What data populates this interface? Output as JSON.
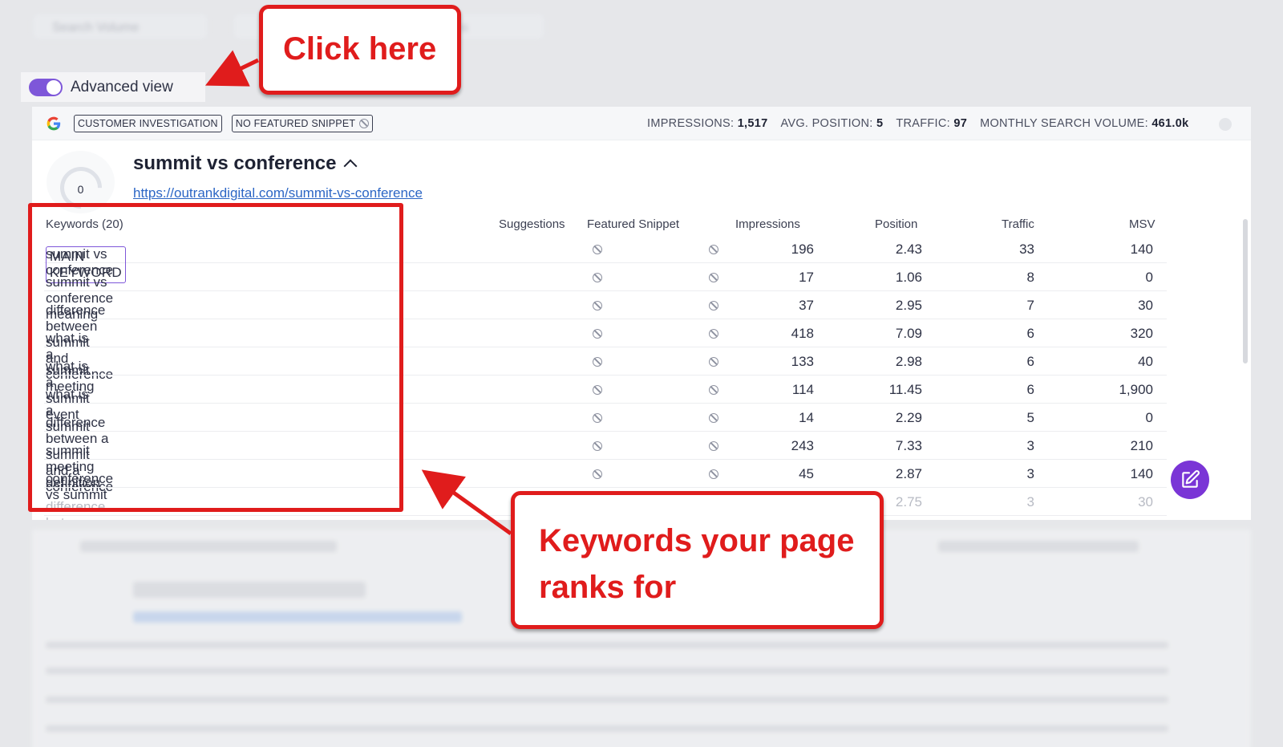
{
  "background_top": {
    "filter1": "Search Volume",
    "filter2": "...ions"
  },
  "toggle": {
    "label": "Advanced view",
    "on": true
  },
  "card": {
    "tags": [
      "CUSTOMER INVESTIGATION",
      "NO FEATURED SNIPPET"
    ],
    "metrics": [
      {
        "label": "IMPRESSIONS:",
        "value": "1,517"
      },
      {
        "label": "AVG. POSITION:",
        "value": "5"
      },
      {
        "label": "TRAFFIC:",
        "value": "97"
      },
      {
        "label": "MONTHLY SEARCH VOLUME:",
        "value": "461.0k"
      }
    ],
    "score": "0",
    "title": "summit vs conference",
    "url": "https://outrankdigital.com/summit-vs-conference",
    "columns": {
      "keywords": "Keywords (20)",
      "suggestions": "Suggestions",
      "featured": "Featured Snippet",
      "impressions": "Impressions",
      "position": "Position",
      "traffic": "Traffic",
      "msv": "MSV"
    },
    "main_keyword_tag": "MAIN KEYWORD",
    "rows": [
      {
        "keyword": "summit vs conference",
        "main": true,
        "impressions": "196",
        "position": "2.43",
        "traffic": "33",
        "msv": "140"
      },
      {
        "keyword": "summit vs conference meaning",
        "impressions": "17",
        "position": "1.06",
        "traffic": "8",
        "msv": "0"
      },
      {
        "keyword": "difference between summit and conference",
        "impressions": "37",
        "position": "2.95",
        "traffic": "7",
        "msv": "30"
      },
      {
        "keyword": "what is a summit meeting",
        "impressions": "418",
        "position": "7.09",
        "traffic": "6",
        "msv": "320"
      },
      {
        "keyword": "what is a summit event",
        "impressions": "133",
        "position": "2.98",
        "traffic": "6",
        "msv": "40"
      },
      {
        "keyword": "what is a summit",
        "impressions": "114",
        "position": "11.45",
        "traffic": "6",
        "msv": "1,900"
      },
      {
        "keyword": "difference between a summit and a conference",
        "impressions": "14",
        "position": "2.29",
        "traffic": "5",
        "msv": "0"
      },
      {
        "keyword": "summit meeting definition",
        "impressions": "243",
        "position": "7.33",
        "traffic": "3",
        "msv": "210"
      },
      {
        "keyword": "conference vs summit",
        "impressions": "45",
        "position": "2.87",
        "traffic": "3",
        "msv": "140"
      },
      {
        "keyword": "difference between conference and summit",
        "impressions": "",
        "position": "2.75",
        "traffic": "3",
        "msv": "30"
      }
    ]
  },
  "annotations": {
    "click_here": "Click here",
    "keywords_line1": "Keywords your page",
    "keywords_line2": "ranks for"
  },
  "colors": {
    "accent": "#7e57d9",
    "annotation_red": "#e01c1c",
    "link": "#2c66c5"
  }
}
